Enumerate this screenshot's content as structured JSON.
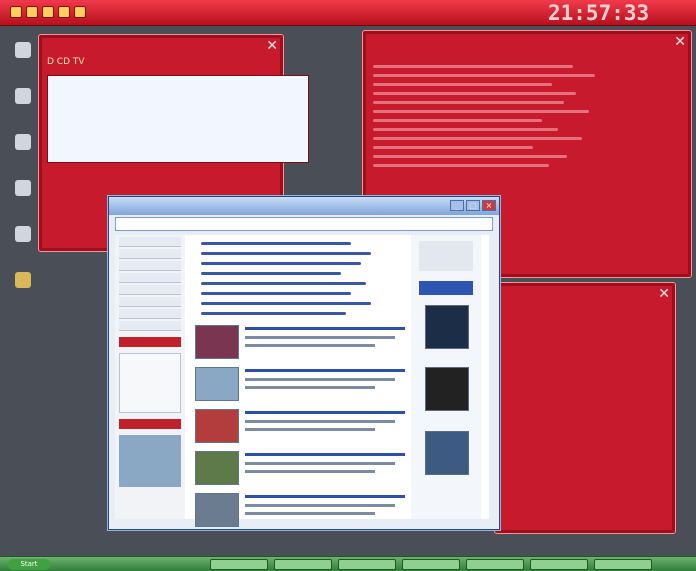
{
  "topbar": {
    "title": "",
    "clock": "21:57:33",
    "clock_sub": "",
    "quick_launch_icons": [
      "app-icon",
      "app-icon",
      "app-icon",
      "app-icon",
      "app-icon"
    ]
  },
  "desktop_icons": [
    {
      "icon": "browser-icon",
      "label": ""
    },
    {
      "icon": "app-icon",
      "label": ""
    },
    {
      "icon": "app-icon",
      "label": ""
    },
    {
      "icon": "app-icon",
      "label": ""
    },
    {
      "icon": "app-icon",
      "label": ""
    },
    {
      "icon": "folder-icon",
      "label": ""
    }
  ],
  "tv_window": {
    "title": "",
    "toolbar_text": "D  CD  TV",
    "list_items": []
  },
  "log_window": {
    "title": ""
  },
  "calendar_window": {
    "title": "",
    "days_header": [
      "",
      "",
      "",
      "",
      "",
      "",
      ""
    ],
    "rows": [
      [
        "",
        "",
        "",
        "",
        "",
        "",
        ""
      ],
      [
        "",
        "",
        "",
        "",
        "",
        "",
        ""
      ],
      [
        "",
        "",
        "",
        "",
        "",
        "",
        ""
      ],
      [
        "",
        "",
        "",
        "",
        "",
        "",
        ""
      ],
      [
        "",
        "",
        "",
        "",
        "",
        "",
        ""
      ],
      [
        "",
        "",
        "",
        "",
        "",
        "",
        ""
      ]
    ]
  },
  "browser": {
    "title": "",
    "title_buttons": [
      "_",
      "□",
      "×"
    ]
  },
  "taskbar": {
    "start_label": "Start",
    "items": [
      "",
      "",
      "",
      "",
      "",
      "",
      ""
    ]
  },
  "theme": {
    "red": "#c81a2d",
    "browser_blue": "#24477d",
    "taskbar_green": "#2f7f3a"
  }
}
